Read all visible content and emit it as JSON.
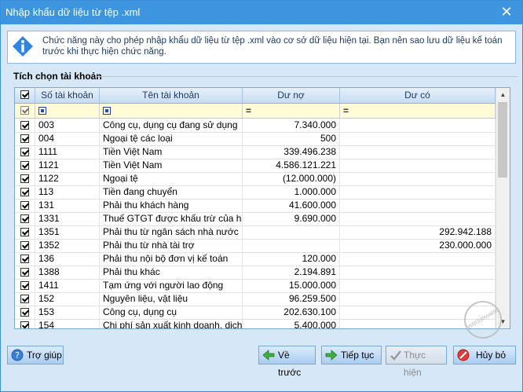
{
  "window": {
    "title": "Nhập khẩu dữ liệu từ tệp .xml",
    "close_glyph": "✕"
  },
  "info": {
    "icon": "info-icon",
    "text": "Chức năng này cho phép nhập khẩu dữ liệu từ tệp .xml vào cơ sở dữ liệu hiện tại. Bạn nên sao lưu dữ liệu kế toán trước khi thực hiện chức năng."
  },
  "group": {
    "label": "Tích chọn tài khoản"
  },
  "grid": {
    "columns": [
      "Số tài khoản",
      "Tên tài khoản",
      "Dư nợ",
      "Dư có"
    ],
    "filter_eq": [
      "=",
      "="
    ],
    "rows": [
      {
        "code": "003",
        "name": "Công cụ, dụng cụ đang sử dụng",
        "debit": "7.340.000",
        "credit": ""
      },
      {
        "code": "004",
        "name": "Ngoại tệ các loại",
        "debit": "500",
        "credit": ""
      },
      {
        "code": "1111",
        "name": "Tiền Việt Nam",
        "debit": "339.496.238",
        "credit": ""
      },
      {
        "code": "1121",
        "name": "Tiền Việt Nam",
        "debit": "4.586.121.221",
        "credit": ""
      },
      {
        "code": "1122",
        "name": "Ngoại tệ",
        "debit": "(12.000.000)",
        "credit": ""
      },
      {
        "code": "113",
        "name": "Tiền đang chuyển",
        "debit": "1.000.000",
        "credit": ""
      },
      {
        "code": "131",
        "name": "Phải thu khách hàng",
        "debit": "41.600.000",
        "credit": ""
      },
      {
        "code": "1331",
        "name": "Thuế GTGT được khấu trừ của hà...",
        "debit": "9.690.000",
        "credit": ""
      },
      {
        "code": "1351",
        "name": "Phải thu từ ngân sách nhà nước",
        "debit": "",
        "credit": "292.942.188"
      },
      {
        "code": "1352",
        "name": "Phải thu từ nhà tài trợ",
        "debit": "",
        "credit": "230.000.000"
      },
      {
        "code": "136",
        "name": "Phải thu nội bộ đơn vị kế toán",
        "debit": "120.000",
        "credit": ""
      },
      {
        "code": "1388",
        "name": "Phải thu khác",
        "debit": "2.194.891",
        "credit": ""
      },
      {
        "code": "1411",
        "name": "Tạm ứng với người lao động",
        "debit": "15.000.000",
        "credit": ""
      },
      {
        "code": "152",
        "name": "Nguyên liệu, vật liệu",
        "debit": "96.259.500",
        "credit": ""
      },
      {
        "code": "153",
        "name": "Công cụ, dụng cụ",
        "debit": "202.630.100",
        "credit": ""
      },
      {
        "code": "154",
        "name": "Chi phí sản xuất kinh doanh, dịch...",
        "debit": "5.400.000",
        "credit": ""
      }
    ]
  },
  "buttons": {
    "help": "Trợ giúp",
    "back": "Về trước",
    "next": "Tiếp tục",
    "execute": "Thực hiện",
    "cancel": "Hủy bỏ"
  },
  "colors": {
    "titlebar": "#3d95e0",
    "dialog_bg": "#d6e8f7",
    "filter_row": "#fffbd6"
  }
}
